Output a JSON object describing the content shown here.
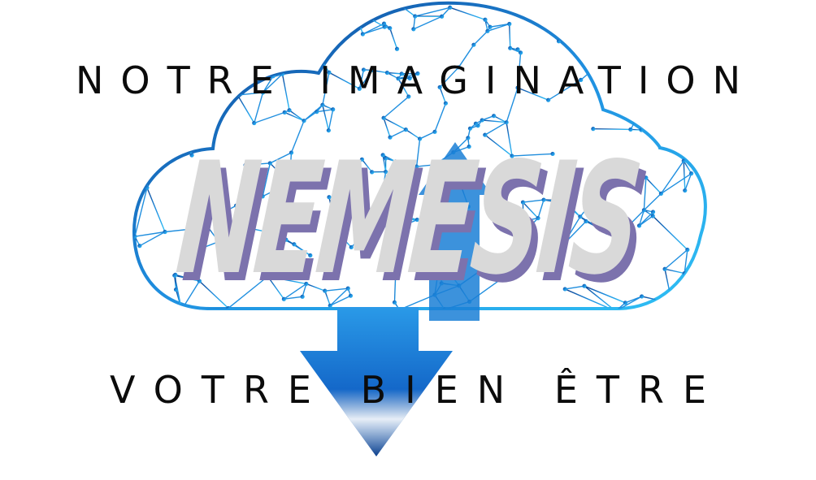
{
  "logo": {
    "tagline_top": "NOTRE IMAGINATION",
    "brand_name": "NEMESIS",
    "tagline_bottom": "VOTRE BIEN ÊTRE"
  },
  "colors": {
    "background": "#ffffff",
    "tagline_text": "#0b0b0b",
    "brand_fill": "#d9d9d9",
    "brand_shadow": "#7c72ad",
    "network_light_blue": "#2fb3f0",
    "network_dark_blue": "#0d3f8f",
    "arrow_blue": "#1a7fd6",
    "arrow_dark": "#0b3f8c"
  },
  "icons": {
    "cloud": "cloud-network-icon",
    "arrow": "download-arrow-icon"
  }
}
